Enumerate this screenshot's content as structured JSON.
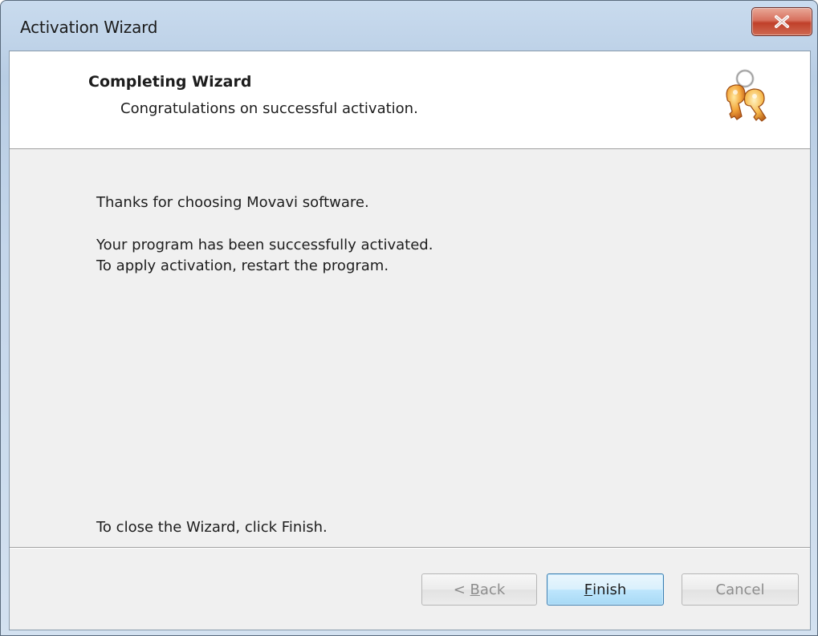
{
  "window": {
    "title": "Activation Wizard",
    "close_icon": "close-icon"
  },
  "header": {
    "title": "Completing Wizard",
    "subtitle": "Congratulations on successful activation.",
    "icon": "keys-icon"
  },
  "body": {
    "thanks": "Thanks for choosing Movavi software.",
    "activated": "Your program has been successfully activated.",
    "restart": "To apply activation, restart the program.",
    "close_hint": "To close the Wizard, click Finish."
  },
  "buttons": {
    "back_prefix": "< ",
    "back_mnemonic": "B",
    "back_rest": "ack",
    "back_enabled": false,
    "finish_mnemonic": "F",
    "finish_rest": "inish",
    "finish_enabled": true,
    "cancel_label": "Cancel",
    "cancel_enabled": false
  },
  "colors": {
    "close_button": "#c0402a",
    "default_button_border": "#3c7fb1",
    "disabled_text": "#8d8d8d"
  }
}
